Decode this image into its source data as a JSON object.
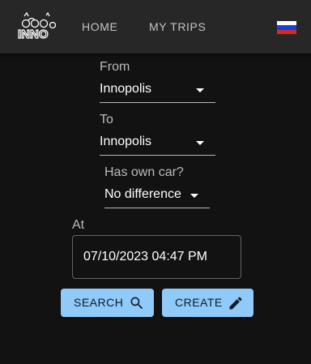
{
  "header": {
    "logo_text": "INNO",
    "nav": [
      "HOME",
      "MY TRIPS"
    ],
    "language_flag": "russian-flag",
    "flag_colors": [
      "#ffffff",
      "#1c3fd6",
      "#d52b1e"
    ]
  },
  "form": {
    "from": {
      "label": "From",
      "value": "Innopolis"
    },
    "to": {
      "label": "To",
      "value": "Innopolis"
    },
    "car": {
      "label": "Has own car?",
      "value": "No difference"
    },
    "at": {
      "label": "At",
      "value": "07/10/2023 04:47 PM"
    }
  },
  "actions": {
    "search": {
      "label": "SEARCH",
      "icon": "search-icon"
    },
    "create": {
      "label": "CREATE",
      "icon": "pencil-icon"
    }
  },
  "colors": {
    "background": "#121212",
    "appbar": "#272727",
    "primary_button": "#90caf9"
  }
}
